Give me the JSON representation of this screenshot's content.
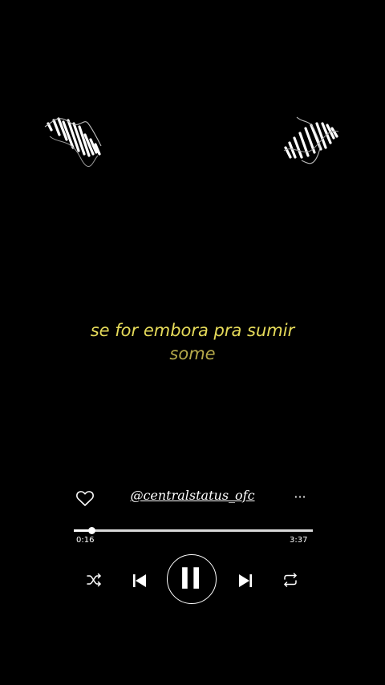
{
  "lyrics": {
    "current_line": "se for embora pra sumir",
    "next_line": "some",
    "current_color": "#e6db5a",
    "next_color": "#b5a94a"
  },
  "decorations": {
    "left_icon": "sound-wave-scribble-icon",
    "right_icon": "sound-wave-scribble-icon"
  },
  "player": {
    "handle": "@centralstatus_ofc",
    "like_icon": "heart-outline-icon",
    "more_icon": "ellipsis-icon",
    "more_label": "···",
    "elapsed": "0:16",
    "total": "3:37",
    "progress_fraction": 0.074,
    "state": "playing",
    "controls": {
      "shuffle_icon": "shuffle-icon",
      "prev_icon": "skip-previous-icon",
      "play_pause_icon": "pause-icon",
      "next_icon": "skip-next-icon",
      "repeat_icon": "repeat-icon"
    }
  }
}
